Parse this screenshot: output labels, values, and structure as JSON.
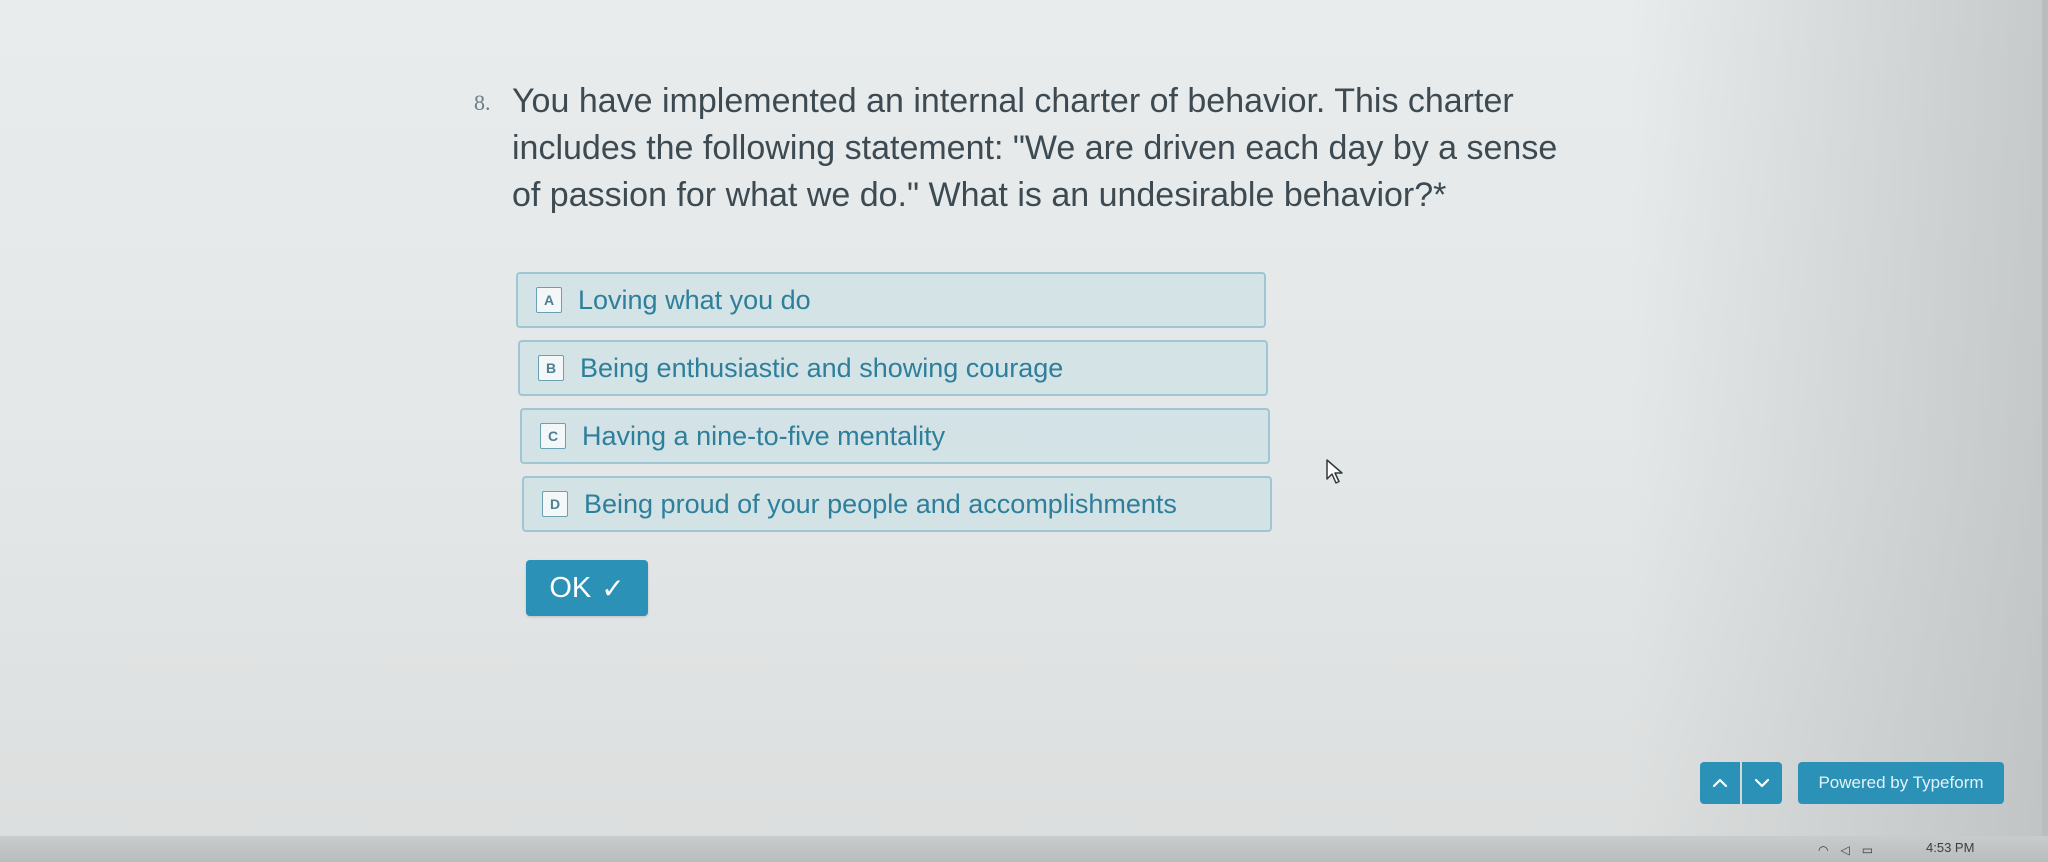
{
  "question": {
    "number": "8.",
    "text": "You have implemented an internal charter of behavior. This charter includes the following statement: \"We are driven each day by a sense of passion for what we do.\" What is an undesirable behavior?*"
  },
  "choices": [
    {
      "key": "A",
      "label": "Loving what you do"
    },
    {
      "key": "B",
      "label": "Being enthusiastic and showing courage"
    },
    {
      "key": "C",
      "label": "Having a nine-to-five mentality"
    },
    {
      "key": "D",
      "label": "Being proud of your people and accomplishments"
    }
  ],
  "ok_button": {
    "label": "OK",
    "check": "✓"
  },
  "footer": {
    "powered_by": "Powered by Typeform"
  },
  "taskbar": {
    "time": "4:53 PM"
  },
  "colors": {
    "accent": "#2b91b7",
    "choice_text": "#2e7f9b",
    "question_text": "#3d4a52"
  }
}
